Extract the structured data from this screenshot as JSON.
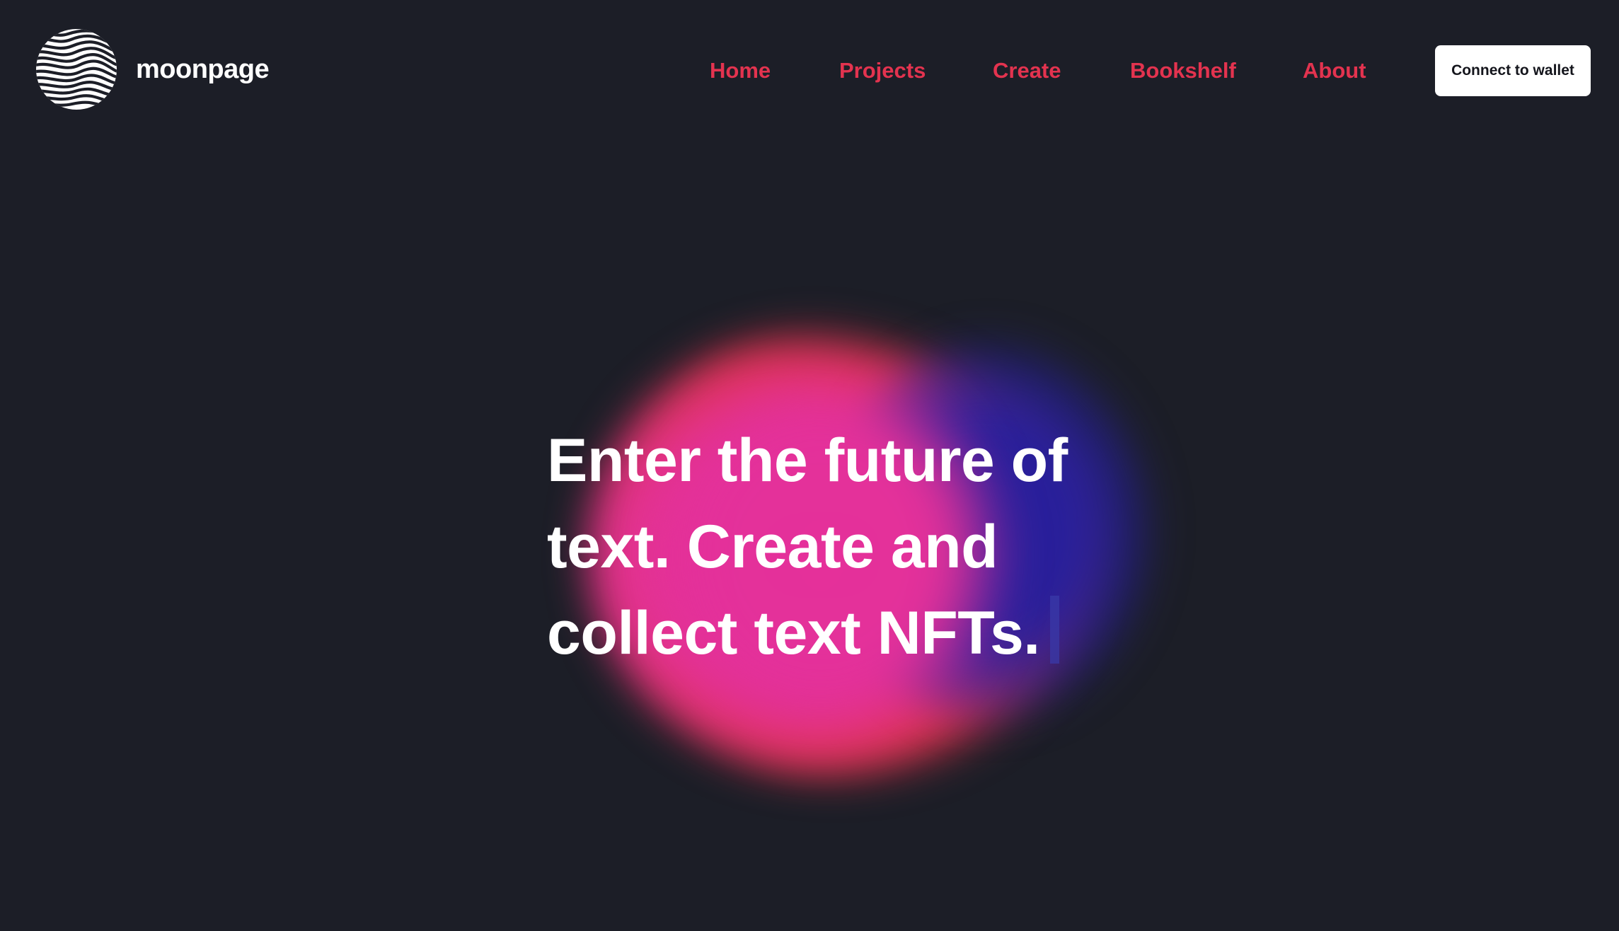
{
  "brand": {
    "name": "moonpage",
    "logo_icon": "wave-globe-icon"
  },
  "nav": {
    "items": [
      {
        "label": "Home"
      },
      {
        "label": "Projects"
      },
      {
        "label": "Create"
      },
      {
        "label": "Bookshelf"
      },
      {
        "label": "About"
      }
    ],
    "color": "#e3334f"
  },
  "header": {
    "connect_label": "Connect to wallet"
  },
  "hero": {
    "lines": [
      "Enter the future of",
      "text. Create and",
      "collect text NFTs."
    ],
    "gradient_colors": [
      "#e0344a",
      "#e5309a",
      "#27209a"
    ]
  },
  "colors": {
    "background": "#1c1e27",
    "text": "#ffffff",
    "button_bg": "#ffffff",
    "button_text": "#14151c"
  }
}
